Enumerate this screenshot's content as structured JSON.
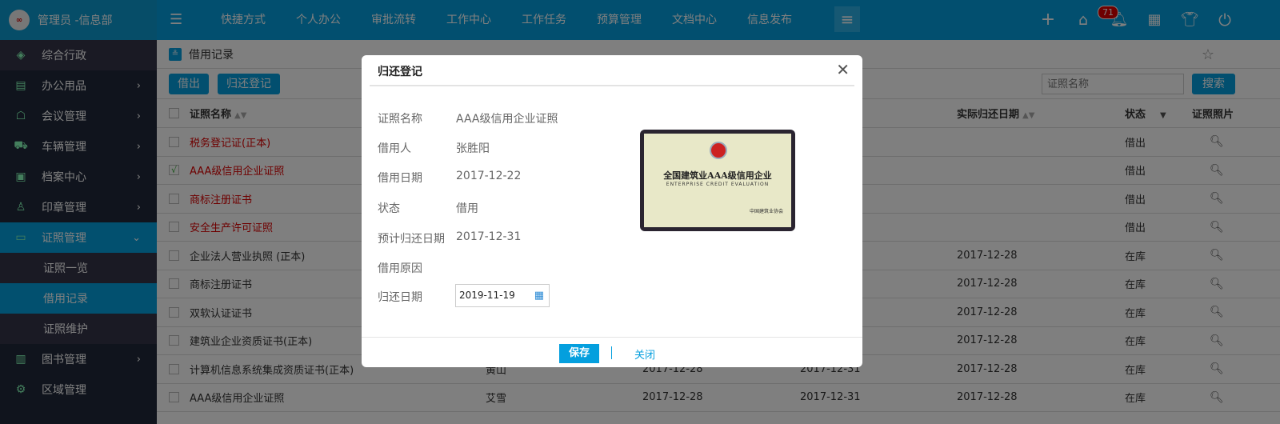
{
  "header": {
    "user": "管理员 -信息部",
    "logo_text": "∞",
    "nav": [
      "快捷方式",
      "个人办公",
      "审批流转",
      "工作中心",
      "工作任务",
      "预算管理",
      "文档中心",
      "信息发布"
    ],
    "notification_count": "71",
    "icons": [
      "plus-icon",
      "home-icon",
      "bell-icon",
      "apps-icon",
      "skin-icon",
      "power-icon"
    ]
  },
  "sidebar": {
    "top": "综合行政",
    "items": [
      {
        "label": "办公用品",
        "icon": "printer-icon"
      },
      {
        "label": "会议管理",
        "icon": "meeting-icon"
      },
      {
        "label": "车辆管理",
        "icon": "car-icon"
      },
      {
        "label": "档案中心",
        "icon": "archive-icon"
      },
      {
        "label": "印章管理",
        "icon": "stamp-icon"
      },
      {
        "label": "证照管理",
        "icon": "id-card-icon",
        "expanded": true
      },
      {
        "label": "图书管理",
        "icon": "book-icon"
      },
      {
        "label": "区域管理",
        "icon": "area-icon"
      }
    ],
    "sub": [
      "证照一览",
      "借用记录",
      "证照维护"
    ],
    "active_sub": "借用记录"
  },
  "page": {
    "breadcrumb": "借用记录",
    "lend_button": "借出",
    "return_button": "归还登记",
    "search_placeholder": "证照名称",
    "search_button": "搜索"
  },
  "table": {
    "headers": [
      "证照名称",
      "",
      "",
      "",
      "实际归还日期",
      "状态",
      "证照照片"
    ],
    "rows": [
      {
        "name": "税务登记证(正本)",
        "red": true,
        "checked": false,
        "c2": "",
        "c3": "",
        "c4": "",
        "actual": "",
        "status": "借出"
      },
      {
        "name": "AAA级信用企业证照",
        "red": true,
        "checked": true,
        "c2": "",
        "c3": "",
        "c4": "",
        "actual": "",
        "status": "借出"
      },
      {
        "name": "商标注册证书",
        "red": true,
        "checked": false,
        "c2": "",
        "c3": "",
        "c4": "",
        "actual": "",
        "status": "借出"
      },
      {
        "name": "安全生产许可证照",
        "red": true,
        "checked": false,
        "c2": "",
        "c3": "",
        "c4": "",
        "actual": "",
        "status": "借出"
      },
      {
        "name": "企业法人营业执照 (正本)",
        "red": false,
        "checked": false,
        "c2": "",
        "c3": "",
        "c4": "",
        "actual": "2017-12-28",
        "status": "在库"
      },
      {
        "name": "商标注册证书",
        "red": false,
        "checked": false,
        "c2": "",
        "c3": "",
        "c4": "",
        "actual": "2017-12-28",
        "status": "在库"
      },
      {
        "name": "双软认证证书",
        "red": false,
        "checked": false,
        "c2": "",
        "c3": "",
        "c4": "",
        "actual": "2017-12-28",
        "status": "在库"
      },
      {
        "name": "建筑业企业资质证书(正本)",
        "red": false,
        "checked": false,
        "c2": "",
        "c3": "",
        "c4": "",
        "actual": "2017-12-28",
        "status": "在库"
      },
      {
        "name": "计算机信息系统集成资质证书(正本)",
        "red": false,
        "checked": false,
        "c2": "黄山",
        "c3": "2017-12-28",
        "c4": "2017-12-31",
        "actual": "2017-12-28",
        "status": "在库"
      },
      {
        "name": "AAA级信用企业证照",
        "red": false,
        "checked": false,
        "c2": "艾雪",
        "c3": "2017-12-28",
        "c4": "2017-12-31",
        "actual": "2017-12-28",
        "status": "在库"
      }
    ]
  },
  "modal": {
    "title": "归还登记",
    "fields": [
      {
        "label": "证照名称",
        "value": "AAA级信用企业证照"
      },
      {
        "label": "借用人",
        "value": "张胜阳"
      },
      {
        "label": "借用日期",
        "value": "2017-12-22"
      },
      {
        "label": "状态",
        "value": "借用"
      },
      {
        "label": "预计归还日期",
        "value": "2017-12-31"
      },
      {
        "label": "借用原因",
        "value": ""
      }
    ],
    "return_date_label": "归还日期",
    "return_date": "2019-11-19",
    "certificate": {
      "title": "全国建筑业AAA级信用企业",
      "subtitle": "ENTERPRISE CREDIT EVALUATION",
      "issuer": "中国建筑业协会"
    },
    "save": "保存",
    "close": "关闭"
  }
}
